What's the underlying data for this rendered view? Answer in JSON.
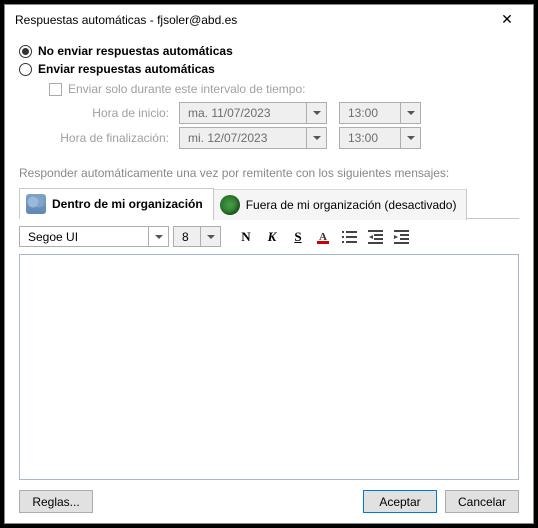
{
  "window": {
    "title": "Respuestas automáticas - fjsoler@abd.es"
  },
  "options": {
    "do_not_send": "No enviar respuestas automáticas",
    "send": "Enviar respuestas automáticas",
    "selected": "do_not_send"
  },
  "time_range": {
    "checkbox_label": "Enviar solo durante este intervalo de tiempo:",
    "start_label": "Hora de inicio:",
    "end_label": "Hora de finalización:",
    "start_date": "ma. 11/07/2023",
    "start_time": "13:00",
    "end_date": "mi. 12/07/2023",
    "end_time": "13:00"
  },
  "section_label": "Responder automáticamente una vez por remitente con los siguientes mensajes:",
  "tabs": {
    "inside": "Dentro de mi organización",
    "outside": "Fuera de mi organización (desactivado)"
  },
  "toolbar": {
    "font": "Segoe UI",
    "size": "8",
    "bold": "N",
    "italic": "K",
    "underline": "S"
  },
  "message_body": "",
  "buttons": {
    "rules": "Reglas...",
    "ok": "Aceptar",
    "cancel": "Cancelar"
  }
}
